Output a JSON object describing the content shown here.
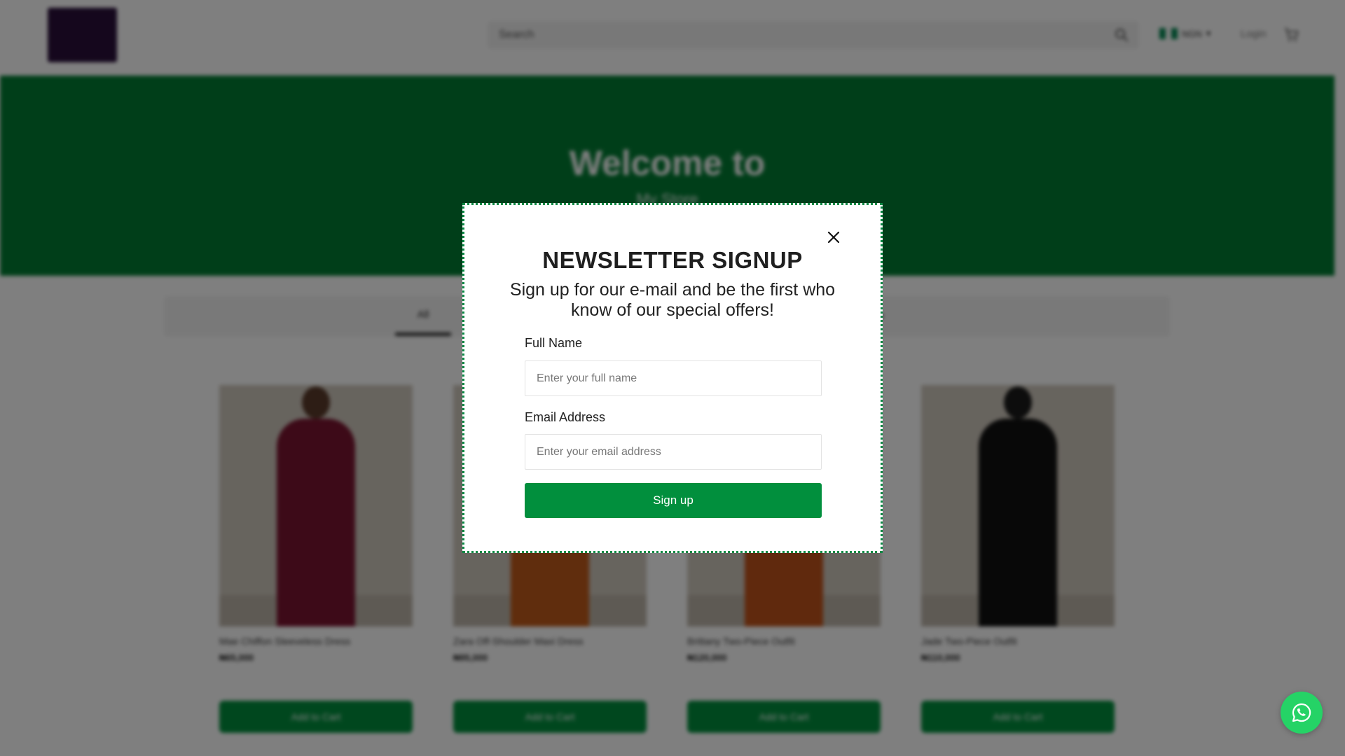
{
  "header": {
    "search_placeholder": "Search",
    "currency": "NGN",
    "login_label": "Login"
  },
  "hero": {
    "title": "Welcome to",
    "subtitle": "My Store",
    "background_color": "#017d33"
  },
  "tabs": {
    "active_label": "All"
  },
  "products": [
    {
      "name": "Mae Chiffon Sleeveless Dress",
      "price": "₦65,000",
      "button_label": "Add to Cart",
      "color": "#7a1530"
    },
    {
      "name": "Zara Off-Shoulder Maxi Dress",
      "price": "₦95,000",
      "button_label": "Add to Cart",
      "color": "#c15a1a"
    },
    {
      "name": "Brittany Two-Piece Outfit",
      "price": "₦120,000",
      "button_label": "Add to Cart",
      "color": "#c0521a"
    },
    {
      "name": "Jade Two-Piece Outfit",
      "price": "₦110,000",
      "button_label": "Add to Cart",
      "color": "#111111"
    }
  ],
  "modal": {
    "title": "NEWSLETTER SIGNUP",
    "subtitle": "Sign up for our e-mail and be the first who know of our special offers!",
    "full_name_label": "Full Name",
    "full_name_placeholder": "Enter your full name",
    "email_label": "Email Address",
    "email_placeholder": "Enter your email address",
    "submit_label": "Sign up",
    "close_icon": "close-icon"
  },
  "icons": {
    "search": "search-icon",
    "cart": "cart-icon",
    "whatsapp": "whatsapp-icon",
    "flag": "nigeria-flag-icon"
  },
  "colors": {
    "brand_green": "#018f3d",
    "modal_border": "#0a8a45",
    "whatsapp": "#25d366"
  }
}
